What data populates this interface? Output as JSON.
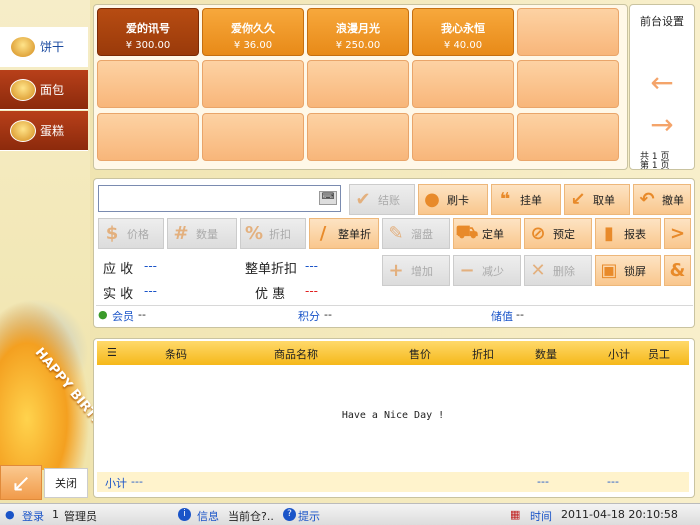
{
  "sidebar": {
    "categories": [
      "饼干",
      "面包",
      "蛋糕"
    ],
    "close_label": "关闭"
  },
  "cake_text": "HAPPY BIRTH",
  "products": [
    {
      "name": "爱的讯号",
      "price": "¥ 300.00"
    },
    {
      "name": "爱你久久",
      "price": "¥ 36.00"
    },
    {
      "name": "浪漫月光",
      "price": "¥ 250.00"
    },
    {
      "name": "我心永恒",
      "price": "¥ 40.00"
    }
  ],
  "nav": {
    "title": "前台设置",
    "page_total": "共 1 页",
    "page_current": "第 1 页"
  },
  "toolbar1": [
    "结账",
    "刷卡",
    "挂单",
    "取单",
    "撤单"
  ],
  "toolbar2": [
    "价格",
    "数量",
    "折扣",
    "整单折",
    "溜盘",
    "定单",
    "预定",
    "报表"
  ],
  "toolbar3": [
    "增加",
    "减少",
    "删除",
    "锁屏"
  ],
  "summary": {
    "ys": "应 收",
    "ss": "实 收",
    "zd": "整单折扣",
    "yh": "优 惠",
    "ys_val": "---",
    "ss_val": "---",
    "zd_val": "---",
    "yh_val": "---"
  },
  "member": {
    "member_label": "会员",
    "member_val": "--",
    "points_label": "积分",
    "points_val": "--",
    "stored_label": "储值",
    "stored_val": "--"
  },
  "table": {
    "headers": [
      "条码",
      "商品名称",
      "售价",
      "折扣",
      "数量",
      "小计",
      "员工"
    ],
    "empty": "Have a Nice Day !"
  },
  "footer": {
    "label": "小计",
    "v1": "---",
    "v2": "---",
    "v3": "---"
  },
  "status": {
    "login": "登录",
    "num": "1",
    "user": "管理员",
    "info": "信息",
    "info_text": "当前仓?..",
    "hint": "提示",
    "time_label": "时间",
    "time": "2011-04-18 20:10:58"
  }
}
